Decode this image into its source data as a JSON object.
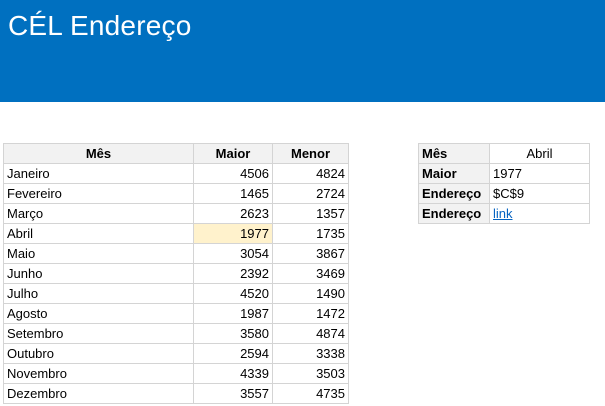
{
  "header": {
    "title": "CÉL Endereço"
  },
  "main_table": {
    "columns": [
      "Mês",
      "Maior",
      "Menor"
    ],
    "rows": [
      [
        "Janeiro",
        "4506",
        "4824"
      ],
      [
        "Fevereiro",
        "1465",
        "2724"
      ],
      [
        "Março",
        "2623",
        "1357"
      ],
      [
        "Abril",
        "1977",
        "1735"
      ],
      [
        "Maio",
        "3054",
        "3867"
      ],
      [
        "Junho",
        "2392",
        "3469"
      ],
      [
        "Julho",
        "4520",
        "1490"
      ],
      [
        "Agosto",
        "1987",
        "1472"
      ],
      [
        "Setembro",
        "3580",
        "4874"
      ],
      [
        "Outubro",
        "2594",
        "3338"
      ],
      [
        "Novembro",
        "4339",
        "3503"
      ],
      [
        "Dezembro",
        "3557",
        "4735"
      ]
    ],
    "highlight_color": "#fff2cc"
  },
  "side_table": {
    "rows": [
      {
        "label": "Mês",
        "value": "Abril"
      },
      {
        "label": "Maior",
        "value": "1977"
      },
      {
        "label": "Endereço",
        "value": "$C$9"
      },
      {
        "label": "Endereço",
        "value": "link"
      }
    ]
  },
  "colors": {
    "banner": "#0070c0",
    "link": "#0563c1"
  }
}
